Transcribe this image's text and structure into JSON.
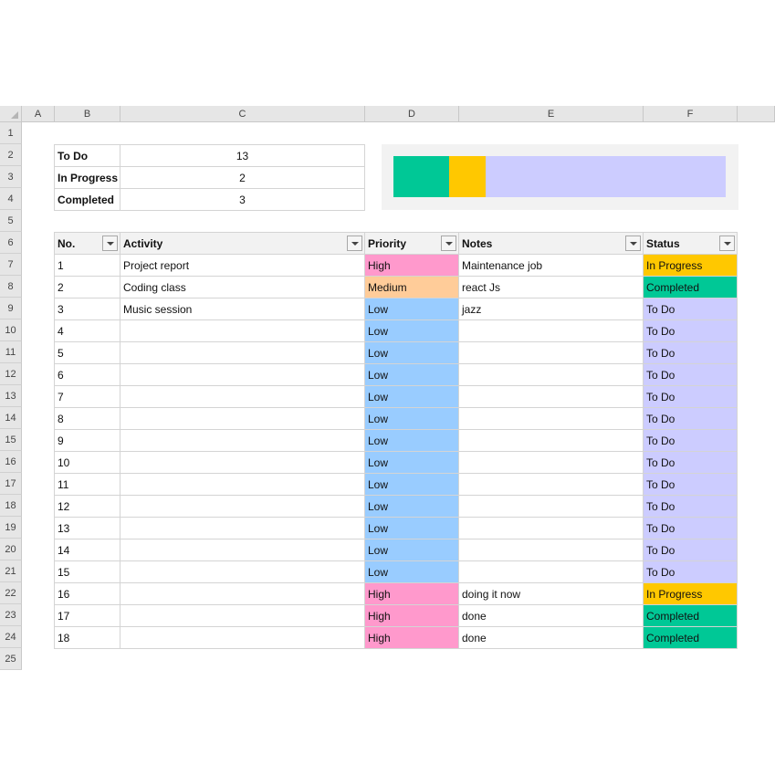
{
  "columns": [
    {
      "label": "A"
    },
    {
      "label": "B"
    },
    {
      "label": "C"
    },
    {
      "label": "D"
    },
    {
      "label": "E"
    },
    {
      "label": "F"
    }
  ],
  "rows": [
    "1",
    "2",
    "3",
    "4",
    "5",
    "6",
    "7",
    "8",
    "9",
    "10",
    "11",
    "12",
    "13",
    "14",
    "15",
    "16",
    "17",
    "18",
    "19",
    "20",
    "21",
    "22",
    "23",
    "24",
    "25"
  ],
  "summary": [
    {
      "label": "To Do",
      "count": "13"
    },
    {
      "label": "In Progress",
      "count": "2"
    },
    {
      "label": "Completed",
      "count": "3"
    }
  ],
  "status_bar": {
    "segments": [
      {
        "name": "Completed",
        "value": 3,
        "color": "#00c896"
      },
      {
        "name": "In Progress",
        "value": 2,
        "color": "#ffc800"
      },
      {
        "name": "To Do",
        "value": 13,
        "color": "#ccccff"
      }
    ]
  },
  "table": {
    "headers": [
      "No.",
      "Activity",
      "Priority",
      "Notes",
      "Status"
    ],
    "rows": [
      {
        "no": "1",
        "activity": "Project report",
        "priority": "High",
        "notes": "Maintenance job",
        "status": "In Progress"
      },
      {
        "no": "2",
        "activity": "Coding class",
        "priority": "Medium",
        "notes": "react Js",
        "status": "Completed"
      },
      {
        "no": "3",
        "activity": "Music session",
        "priority": "Low",
        "notes": "jazz",
        "status": "To Do"
      },
      {
        "no": "4",
        "activity": "",
        "priority": "Low",
        "notes": "",
        "status": "To Do"
      },
      {
        "no": "5",
        "activity": "",
        "priority": "Low",
        "notes": "",
        "status": "To Do"
      },
      {
        "no": "6",
        "activity": "",
        "priority": "Low",
        "notes": "",
        "status": "To Do"
      },
      {
        "no": "7",
        "activity": "",
        "priority": "Low",
        "notes": "",
        "status": "To Do"
      },
      {
        "no": "8",
        "activity": "",
        "priority": "Low",
        "notes": "",
        "status": "To Do"
      },
      {
        "no": "9",
        "activity": "",
        "priority": "Low",
        "notes": "",
        "status": "To Do"
      },
      {
        "no": "10",
        "activity": "",
        "priority": "Low",
        "notes": "",
        "status": "To Do"
      },
      {
        "no": "11",
        "activity": "",
        "priority": "Low",
        "notes": "",
        "status": "To Do"
      },
      {
        "no": "12",
        "activity": "",
        "priority": "Low",
        "notes": "",
        "status": "To Do"
      },
      {
        "no": "13",
        "activity": "",
        "priority": "Low",
        "notes": "",
        "status": "To Do"
      },
      {
        "no": "14",
        "activity": "",
        "priority": "Low",
        "notes": "",
        "status": "To Do"
      },
      {
        "no": "15",
        "activity": "",
        "priority": "Low",
        "notes": "",
        "status": "To Do"
      },
      {
        "no": "16",
        "activity": "",
        "priority": "High",
        "notes": "doing it now",
        "status": "In Progress"
      },
      {
        "no": "17",
        "activity": "",
        "priority": "High",
        "notes": "done",
        "status": "Completed"
      },
      {
        "no": "18",
        "activity": "",
        "priority": "High",
        "notes": "done",
        "status": "Completed"
      }
    ]
  },
  "colors": {
    "priority": {
      "High": "#ff99cc",
      "Medium": "#ffcc99",
      "Low": "#99ccff"
    },
    "status": {
      "In Progress": "#ffc800",
      "Completed": "#00c896",
      "To Do": "#ccccff"
    }
  }
}
